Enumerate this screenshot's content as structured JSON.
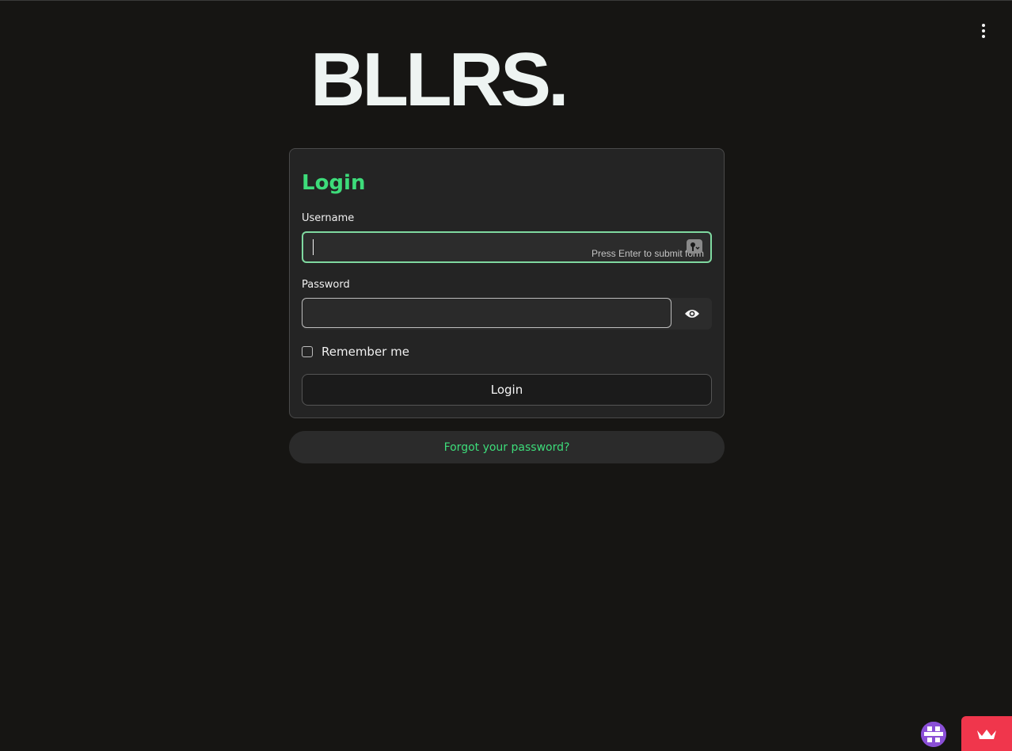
{
  "app": {
    "logo_text": "BLLRS."
  },
  "header": {
    "menu_icon": "more-vertical-icon"
  },
  "login_form": {
    "title": "Login",
    "username": {
      "label": "Username",
      "value": "",
      "hint": "Press Enter to submit form",
      "autofill_icon": "key-icon"
    },
    "password": {
      "label": "Password",
      "value": "",
      "toggle_icon": "eye-icon"
    },
    "remember_me": {
      "label": "Remember me",
      "checked": false
    },
    "submit_label": "Login"
  },
  "forgot_password": {
    "label": "Forgot your password?"
  },
  "footer": {
    "avatar_icon": "avatar-icon",
    "badge_icon": "crown-icon"
  },
  "colors": {
    "background": "#161513",
    "accent": "#3ddc7a",
    "card": "#242424",
    "badge": "#f0364c"
  }
}
